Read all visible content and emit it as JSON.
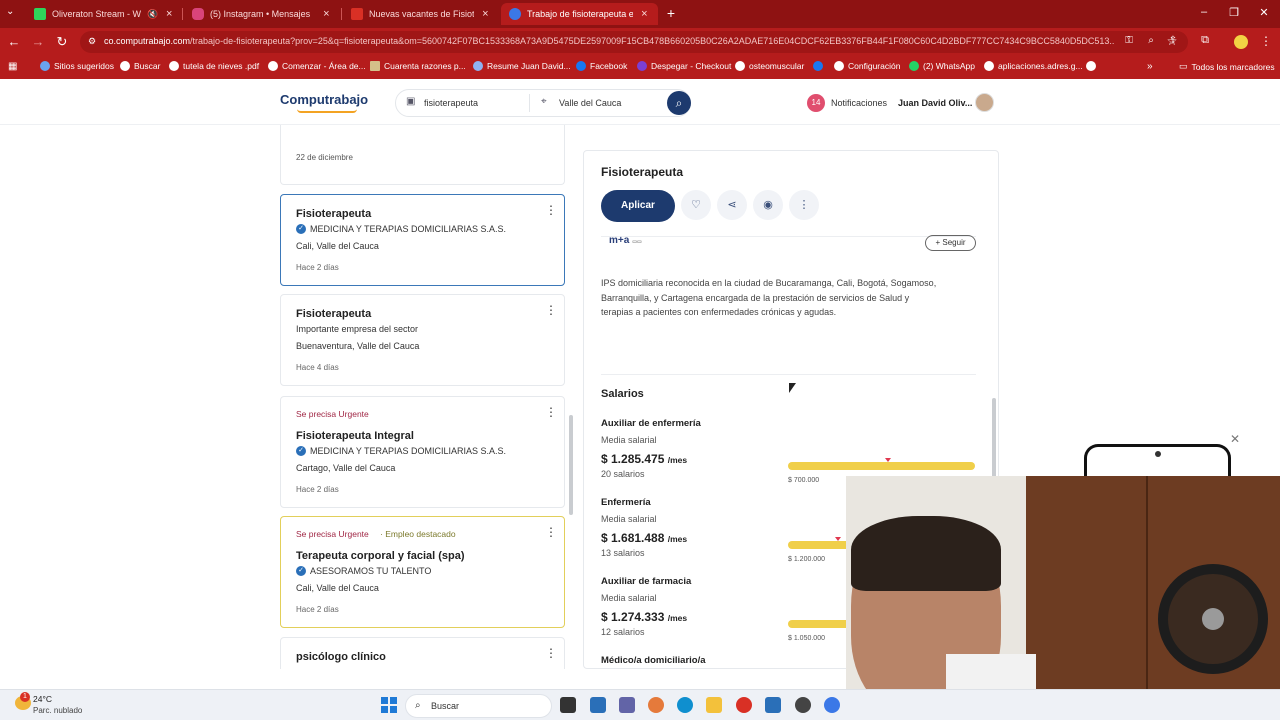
{
  "browser": {
    "tabs": [
      {
        "label": "Oliveraton Stream - Watch",
        "color": "#2fd55a"
      },
      {
        "label": "(5) Instagram • Mensajes",
        "color": "#d9447a"
      },
      {
        "label": "Nuevas vacantes de Fisioterape",
        "color": "#d93025"
      },
      {
        "label": "Trabajo de fisioterapeuta en Va",
        "color": "#3b78e7"
      }
    ],
    "url_host": "co.computrabajo.com",
    "url_path": "/trabajo-de-fisioterapeuta?prov=25&q=fisioterapeuta&om=5600742F07BC1533368A73A9D5475DE2597009F15CB478B660205B0C26A2ADAE716E04CDCF62EB3376FB44F1F080C60C4D2BDF777CC7434C9BCC5840D5DC513...",
    "bookmarks": [
      "Sitios sugeridos",
      "Buscar",
      "tutela de nieves .pdf",
      "Comenzar - Área de...",
      "Cuarenta razones p...",
      "Resume Juan David...",
      "Facebook",
      "Despegar - Checkout",
      "osteomuscular",
      "",
      "Configuración",
      "(2) WhatsApp",
      "aplicaciones.adres.g..."
    ],
    "all_bookmarks": "Todos los marcadores"
  },
  "site": {
    "logo": "Computrabajo",
    "search_query": "fisioterapeuta",
    "search_location": "Valle del Cauca",
    "notif_count": "14",
    "notif_label": "Notificaciones",
    "user_name": "Juan David Oliv..."
  },
  "list": {
    "prev_date": "22 de diciembre",
    "cards": [
      {
        "urgent": "",
        "featured": "",
        "title": "Fisioterapeuta",
        "company": "MEDICINA Y TERAPIAS DOMICILIARIAS S.A.S.",
        "location": "Cali, Valle del Cauca",
        "ago": "Hace 2 días"
      },
      {
        "urgent": "",
        "featured": "",
        "title": "Fisioterapeuta",
        "company": "Importante empresa del sector",
        "location": "Buenaventura, Valle del Cauca",
        "ago": "Hace 4 días"
      },
      {
        "urgent": "Se precisa Urgente",
        "featured": "",
        "title": "Fisioterapeuta Integral",
        "company": "MEDICINA Y TERAPIAS DOMICILIARIAS S.A.S.",
        "location": "Cartago, Valle del Cauca",
        "ago": "Hace 2 días"
      },
      {
        "urgent": "Se precisa Urgente",
        "featured": "Empleo destacado",
        "title": "Terapeuta corporal y facial (spa)",
        "company": "ASESORAMOS TU TALENTO",
        "location": "Cali, Valle del Cauca",
        "ago": "Hace 2 días"
      },
      {
        "urgent": "",
        "featured": "",
        "title": "psicólogo clínico",
        "company": "",
        "location": "",
        "ago": ""
      }
    ]
  },
  "detail": {
    "title": "Fisioterapeuta",
    "apply_label": "Aplicar",
    "company_logo": "m+a",
    "follow_label": "+ Seguir",
    "description": "IPS domiciliaria reconocida en la ciudad de Bucaramanga, Cali, Bogotá, Sogamoso, Barranquilla, y Cartagena encargada de la prestación de servicios de Salud y terapias a pacientes con enfermedades crónicas y agudas.",
    "salaries_heading": "Salarios",
    "salaries": [
      {
        "role": "Auxiliar de enfermería",
        "sub": "Media salarial",
        "amount": "$ 1.285.475",
        "unit": "/mes",
        "count": "20 salarios",
        "min": "$ 700.000"
      },
      {
        "role": "Enfermería",
        "sub": "Media salarial",
        "amount": "$ 1.681.488",
        "unit": "/mes",
        "count": "13 salarios",
        "min": "$ 1.200.000"
      },
      {
        "role": "Auxiliar de farmacia",
        "sub": "Media salarial",
        "amount": "$ 1.274.333",
        "unit": "/mes",
        "count": "12 salarios",
        "min": "$ 1.050.000"
      },
      {
        "role": "Médico/a domiciliario/a",
        "sub": "",
        "amount": "",
        "unit": "",
        "count": "",
        "min": ""
      }
    ]
  },
  "taskbar": {
    "temp": "24°C",
    "weather": "Parc. nublado",
    "weather_badge": "1",
    "search_placeholder": "Buscar"
  }
}
